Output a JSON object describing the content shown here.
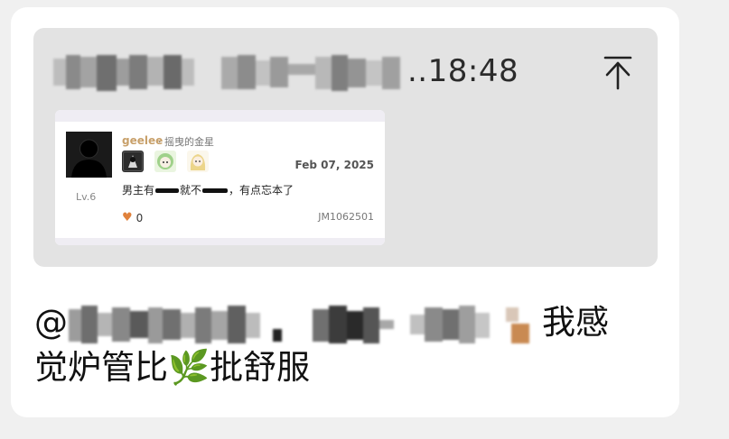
{
  "quoted": {
    "time_suffix": "..18:48",
    "scroll_top_icon": "arrow-to-top-icon",
    "screenshot": {
      "username": "geelee",
      "group": "· 摇曳的金星",
      "level": "Lv.6",
      "date": "Feb 07, 2025",
      "comment_part1": "男主有",
      "comment_part2": "就不",
      "comment_part3": "，有点忘本了",
      "like_icon": "heart-icon",
      "like_count": "0",
      "comment_id": "JM1062501"
    }
  },
  "message": {
    "at_symbol": "@",
    "text_line1_tail": "我感",
    "text_line2_part1": "觉炉管比",
    "emoji": "🌿",
    "text_line2_part2": "批舒服"
  },
  "colors": {
    "quote_bg": "#e3e3e3",
    "username": "#c8a06a",
    "heart": "#e0823c"
  }
}
